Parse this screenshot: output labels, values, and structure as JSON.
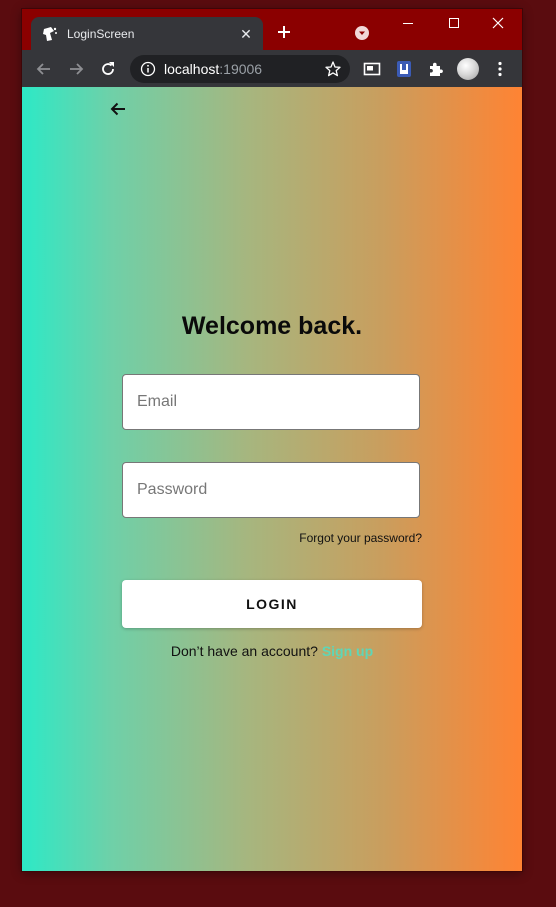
{
  "browser": {
    "tab_title": "LoginScreen",
    "url_host": "localhost",
    "url_port": ":19006"
  },
  "page": {
    "title": "Welcome back.",
    "email_placeholder": "Email",
    "password_placeholder": "Password",
    "forgot_link": "Forgot your password?",
    "login_label": "LOGIN",
    "signup_prompt": "Don’t have an account? ",
    "signup_link": "Sign up"
  },
  "colors": {
    "gradient_left": "#2de9c6",
    "gradient_right": "#ff8333",
    "signup_accent": "#5fd6b6",
    "window_frame": "#8b0000"
  }
}
